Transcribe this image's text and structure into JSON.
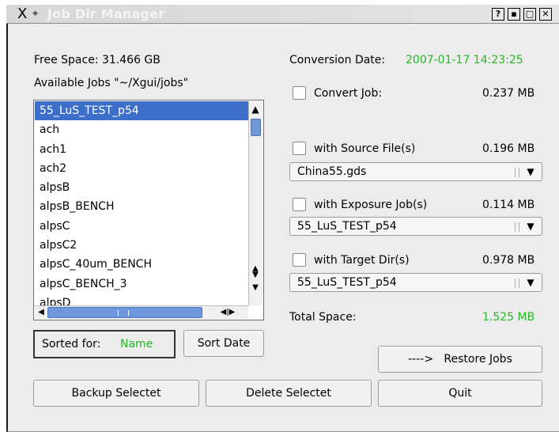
{
  "window": {
    "title": "Job Dir Manager",
    "controls": [
      "?",
      "▪",
      "□",
      "✕"
    ]
  },
  "left": {
    "free_space": "Free Space: 31.466 GB",
    "available_jobs": "Available Jobs \"~/Xgui/jobs\"",
    "jobs": [
      "55_LuS_TEST_p54",
      "ach",
      "ach1",
      "ach2",
      "alpsB",
      "alpsB_BENCH",
      "alpsC",
      "alpsC2",
      "alpsC_40um_BENCH",
      "alpsC_BENCH_3",
      "alpsD"
    ],
    "selected_job": "55_LuS_TEST_p54",
    "sorted_for_label": "Sorted for:",
    "sorted_for_value": "Name",
    "sort_date_button": "Sort Date"
  },
  "right": {
    "conversion_label": "Conversion Date:",
    "conversion_value": "2007-01-17 14:23:25",
    "convert_job": {
      "label": "Convert Job:",
      "size": "0.237 MB",
      "checked": false
    },
    "source": {
      "label": "with Source File(s)",
      "size": "0.196 MB",
      "checked": false,
      "selected": "China55.gds"
    },
    "exposure": {
      "label": "with Exposure Job(s)",
      "size": "0.114 MB",
      "checked": false,
      "selected": "55_LuS_TEST_p54"
    },
    "target": {
      "label": "with Target Dir(s)",
      "size": "0.978 MB",
      "checked": false,
      "selected": "55_LuS_TEST_p54"
    },
    "total_label": "Total Space:",
    "total_value": "1.525 MB",
    "restore_button": "---->   Restore Jobs"
  },
  "bottom": {
    "backup_button": "Backup Selectet",
    "delete_button": "Delete Selectet",
    "quit_button": "Quit"
  },
  "colors": {
    "selection": "#3d6ec8",
    "green_text": "#25b825",
    "window_bg": "#ececec"
  },
  "icons": {
    "app_icon": "x-logo-icon",
    "pin_icon": "pin-icon"
  }
}
